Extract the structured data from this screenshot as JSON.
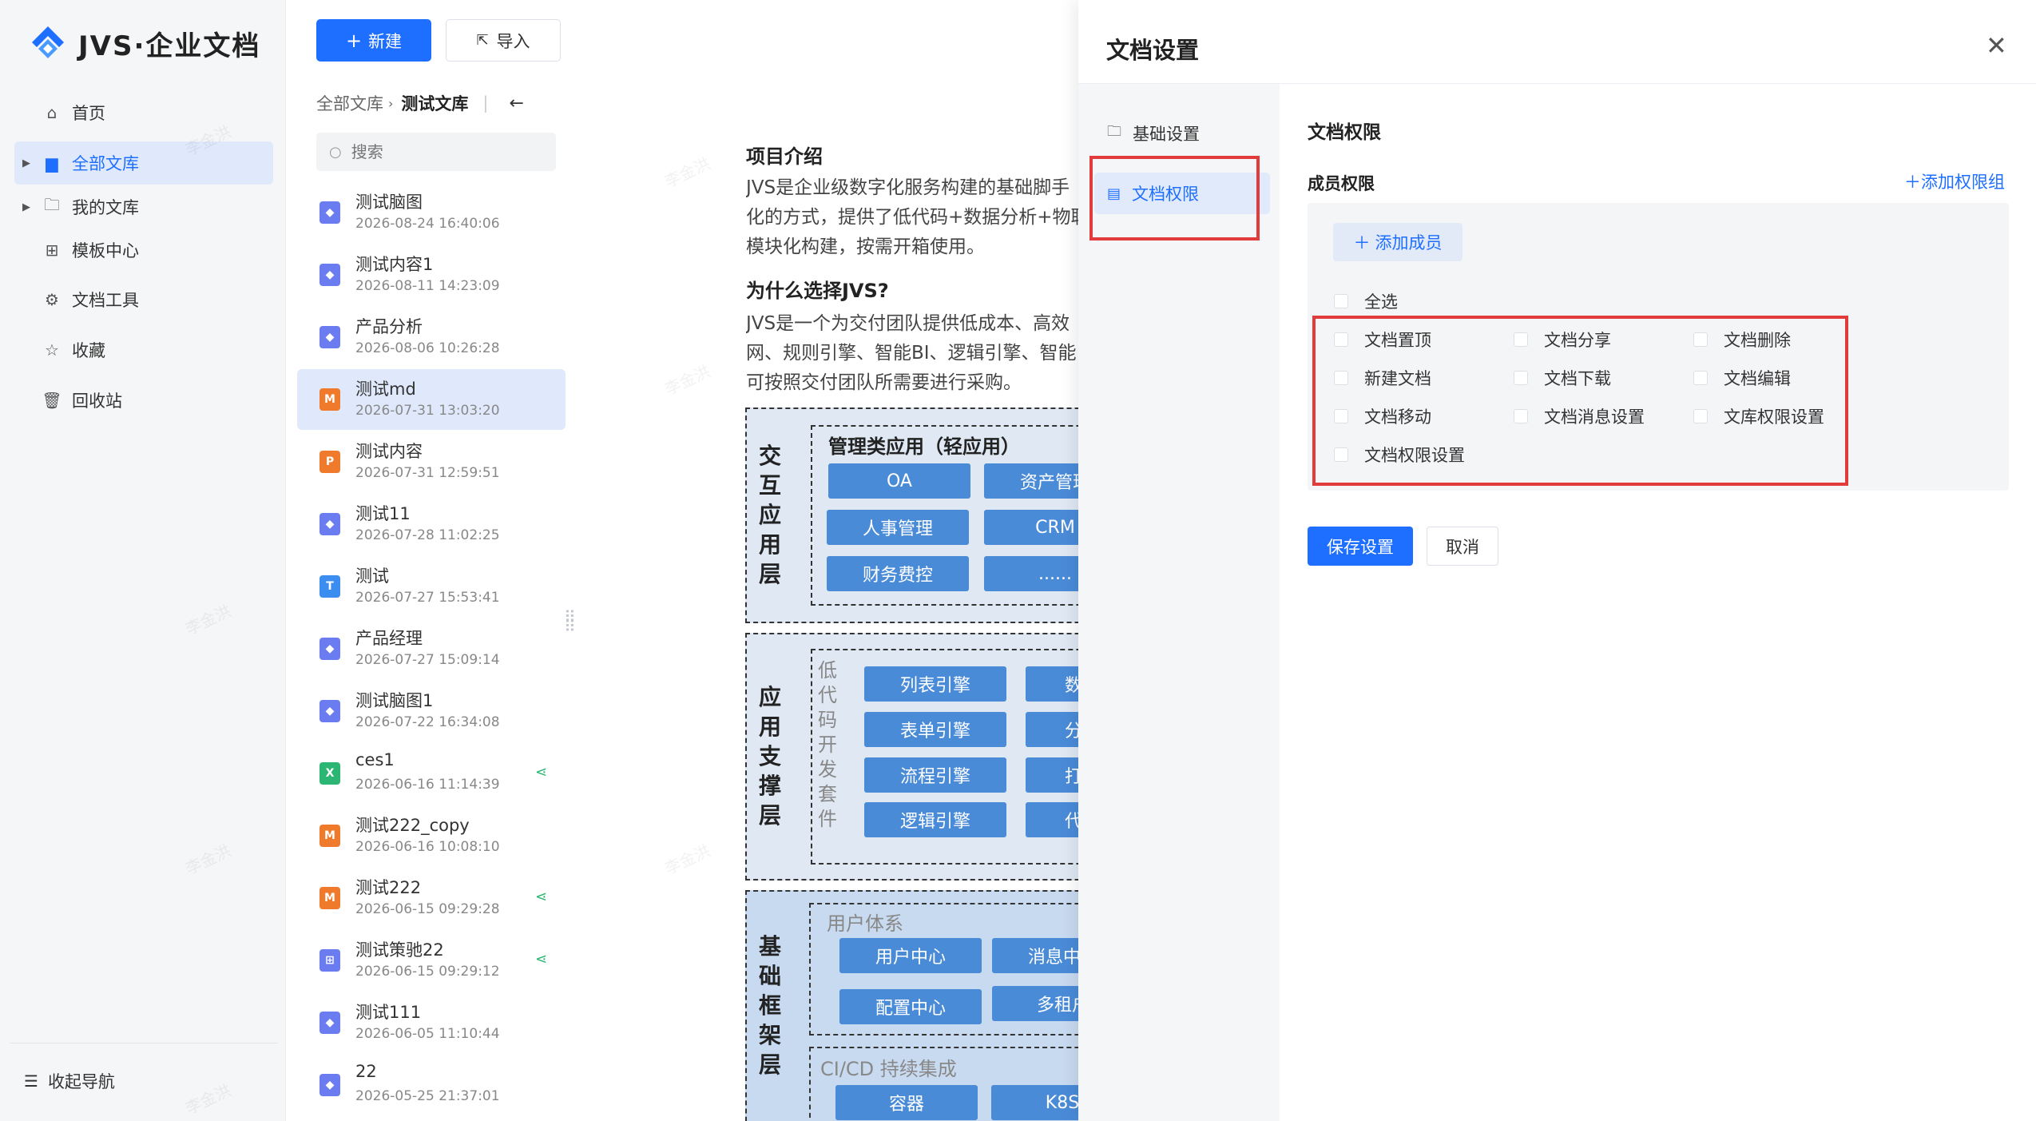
{
  "app": {
    "logo_text": "JVS·企业文档",
    "accent": "#1e6fff"
  },
  "nav": {
    "items": [
      {
        "label": "首页",
        "icon": "home-icon"
      },
      {
        "label": "全部文库",
        "icon": "folder-icon"
      },
      {
        "label": "我的文库",
        "icon": "folder-icon"
      },
      {
        "label": "模板中心",
        "icon": "template-icon"
      },
      {
        "label": "文档工具",
        "icon": "tools-icon"
      },
      {
        "label": "收藏",
        "icon": "star-icon"
      },
      {
        "label": "回收站",
        "icon": "trash-icon"
      }
    ],
    "collapse_label": "收起导航"
  },
  "toolbar": {
    "new_label": "新建",
    "import_label": "导入"
  },
  "breadcrumb": {
    "root": "全部文库",
    "current": "测试文库"
  },
  "search": {
    "placeholder": "搜索"
  },
  "files": [
    {
      "name": "测试脑图",
      "date": "2026-08-24 16:40:06",
      "type": "mindmap",
      "color": "#6b7cf0",
      "glyph": "◆",
      "shared": false
    },
    {
      "name": "测试内容1",
      "date": "2026-08-11 14:23:09",
      "type": "mindmap",
      "color": "#6b7cf0",
      "glyph": "◆",
      "shared": false
    },
    {
      "name": "产品分析",
      "date": "2026-08-06 10:26:28",
      "type": "mindmap",
      "color": "#6b7cf0",
      "glyph": "◆",
      "shared": false
    },
    {
      "name": "测试md",
      "date": "2026-07-31 13:03:20",
      "type": "markdown",
      "color": "#f07a2b",
      "glyph": "M",
      "shared": false
    },
    {
      "name": "测试内容",
      "date": "2026-07-31 12:59:51",
      "type": "ppt",
      "color": "#f07a2b",
      "glyph": "P",
      "shared": false
    },
    {
      "name": "测试11",
      "date": "2026-07-28 11:02:25",
      "type": "mindmap",
      "color": "#6b7cf0",
      "glyph": "◆",
      "shared": false
    },
    {
      "name": "测试",
      "date": "2026-07-27 15:53:41",
      "type": "text",
      "color": "#3b8ef0",
      "glyph": "T",
      "shared": false
    },
    {
      "name": "产品经理",
      "date": "2026-07-27 15:09:14",
      "type": "mindmap",
      "color": "#6b7cf0",
      "glyph": "◆",
      "shared": false
    },
    {
      "name": "测试脑图1",
      "date": "2026-07-22 16:34:08",
      "type": "mindmap",
      "color": "#6b7cf0",
      "glyph": "◆",
      "shared": false
    },
    {
      "name": "ces1",
      "date": "2026-06-16 11:14:39",
      "type": "excel",
      "color": "#2bb673",
      "glyph": "X",
      "shared": true
    },
    {
      "name": "测试222_copy",
      "date": "2026-06-16 10:08:10",
      "type": "markdown",
      "color": "#f07a2b",
      "glyph": "M",
      "shared": false
    },
    {
      "name": "测试222",
      "date": "2026-06-15 09:29:28",
      "type": "markdown",
      "color": "#f07a2b",
      "glyph": "M",
      "shared": true
    },
    {
      "name": "测试策驰22",
      "date": "2026-06-15 09:29:12",
      "type": "flow",
      "color": "#6b7cf0",
      "glyph": "⊞",
      "shared": true
    },
    {
      "name": "测试111",
      "date": "2026-06-05 11:10:44",
      "type": "mindmap",
      "color": "#6b7cf0",
      "glyph": "◆",
      "shared": false
    },
    {
      "name": "22",
      "date": "2026-05-25 21:37:01",
      "type": "mindmap",
      "color": "#6b7cf0",
      "glyph": "◆",
      "shared": false
    }
  ],
  "doc": {
    "h1": "项目介绍",
    "p1": [
      "JVS是企业级数字化服务构建的基础脚手",
      "化的方式，提供了低代码+数据分析+物联",
      "模块化构建，按需开箱使用。"
    ],
    "h2": "为什么选择JVS?",
    "p2": [
      "JVS是一个为交付团队提供低成本、高效",
      "网、规则引擎、智能BI、逻辑引擎、智能",
      "可按照交付团队所需要进行采购。"
    ],
    "arch": {
      "layer1": {
        "title": [
          "交",
          "互",
          "应",
          "用",
          "层"
        ],
        "group": "管理类应用（轻应用）",
        "pills": [
          "OA",
          "资产管理",
          "人事管理",
          "CRM",
          "财务费控",
          "......"
        ]
      },
      "layer2": {
        "title": [
          "应",
          "用",
          "支",
          "撑",
          "层"
        ],
        "sub": [
          "低",
          "代",
          "码",
          "开",
          "发",
          "套",
          "件"
        ],
        "pills": [
          "列表引擎",
          "表单引擎",
          "流程引擎",
          "逻辑引擎",
          "数",
          "分",
          "打",
          "代"
        ]
      },
      "layer3": {
        "title": [
          "基",
          "础",
          "框",
          "架",
          "层"
        ],
        "group1": "用户体系",
        "pills1": [
          "用户中心",
          "消息中心",
          "配置中心",
          "多租户"
        ],
        "group2": "CI/CD 持续集成",
        "pills2": [
          "容器",
          "K8S"
        ]
      }
    }
  },
  "watermark": "李金洪",
  "modal": {
    "title": "文档设置",
    "tabs": [
      {
        "label": "基础设置",
        "icon": "folder-icon"
      },
      {
        "label": "文档权限",
        "icon": "permission-icon"
      }
    ],
    "section_title": "文档权限",
    "member_title": "成员权限",
    "add_group_label": "添加权限组",
    "add_member_label": "添加成员",
    "select_all": "全选",
    "permissions": [
      "文档置顶",
      "文档分享",
      "文档删除",
      "新建文档",
      "文档下载",
      "文档编辑",
      "文档移动",
      "文档消息设置",
      "文库权限设置",
      "文档权限设置"
    ],
    "save_label": "保存设置",
    "cancel_label": "取消"
  }
}
